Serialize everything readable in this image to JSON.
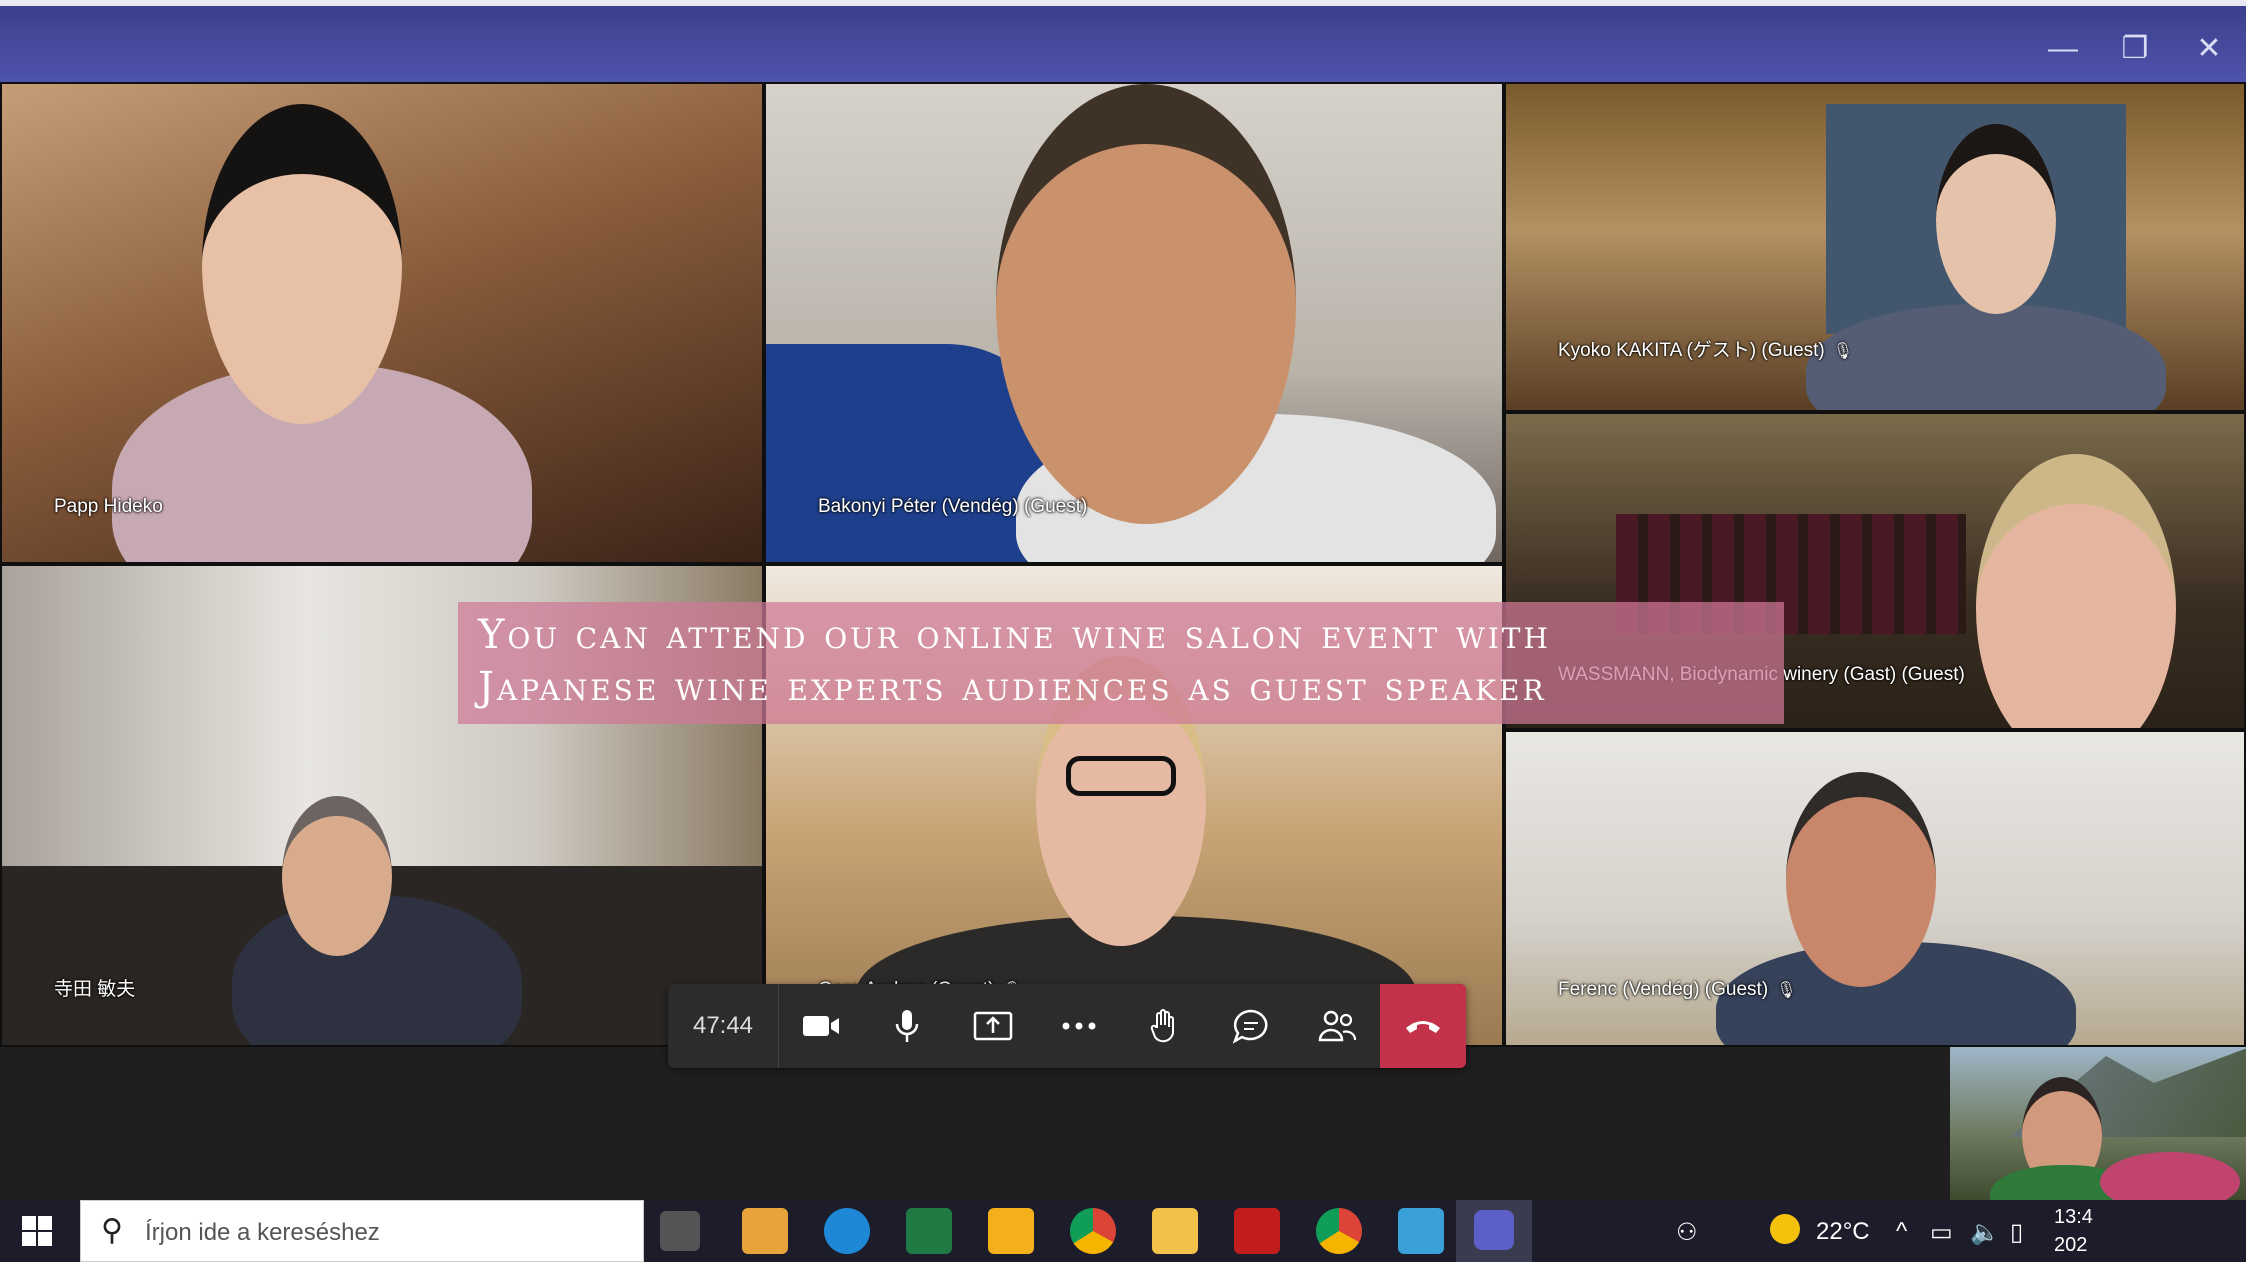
{
  "window": {
    "minimize": "—",
    "restore": "❐",
    "close": "✕"
  },
  "participants": [
    {
      "name": "Papp Hideko",
      "muted": false
    },
    {
      "name": "Bakonyi Péter (Vendég) (Guest)",
      "muted": false
    },
    {
      "name": "Kyoko KAKITA (ゲスト) (Guest)",
      "muted": true
    },
    {
      "name": "WASSMANN, Biodynamic winery (Gast) (Guest)",
      "muted": false
    },
    {
      "name": "寺田 敏夫",
      "muted": false
    },
    {
      "name": "Gere Andrea (Guest)",
      "muted": true
    },
    {
      "name": "Ferenc (Vendég) (Guest)",
      "muted": true
    }
  ],
  "banner": {
    "line1": "You can attend our online wine salon event with",
    "line2": "Japanese wine experts audiences as guest speaker"
  },
  "controls": {
    "timer": "47:44",
    "icons": [
      "camera-icon",
      "microphone-icon",
      "share-screen-icon",
      "more-icon",
      "raise-hand-icon",
      "chat-icon",
      "participants-icon",
      "hang-up-icon"
    ]
  },
  "taskbar": {
    "search_placeholder": "Írjon ide a kereséshez",
    "temperature": "22°C",
    "time": "13:4",
    "date": "202"
  },
  "colors": {
    "titlebar": "#4f54ac",
    "hangup": "#c4314b",
    "banner": "#ce7896"
  }
}
